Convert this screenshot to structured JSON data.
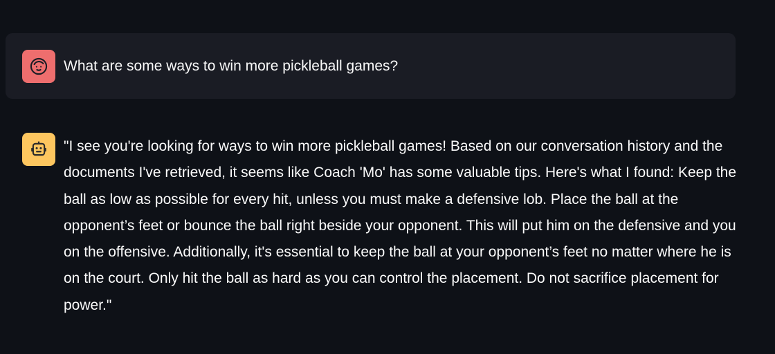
{
  "messages": [
    {
      "role": "user",
      "avatar_icon": "face-icon",
      "avatar_color": "#ee6e6e",
      "text": "What are some ways to win more pickleball games?"
    },
    {
      "role": "assistant",
      "avatar_icon": "robot-icon",
      "avatar_color": "#fdc65f",
      "text": "\"I see you're looking for ways to win more pickleball games! Based on our conversation history and the documents I've retrieved, it seems like Coach 'Mo' has some valuable tips. Here's what I found: Keep the ball as low as possible for every hit, unless you must make a defensive lob. Place the ball at the opponent’s feet or bounce the ball right beside your opponent. This will put him on the defensive and you on the offensive. Additionally, it's essential to keep the ball at your opponent’s feet no matter where he is on the court. Only hit the ball as hard as you can control the placement. Do not sacrifice placement for power.\""
    }
  ],
  "colors": {
    "background": "#0e1117",
    "user_message_bg": "#1a1c24",
    "text": "#fafafa"
  }
}
